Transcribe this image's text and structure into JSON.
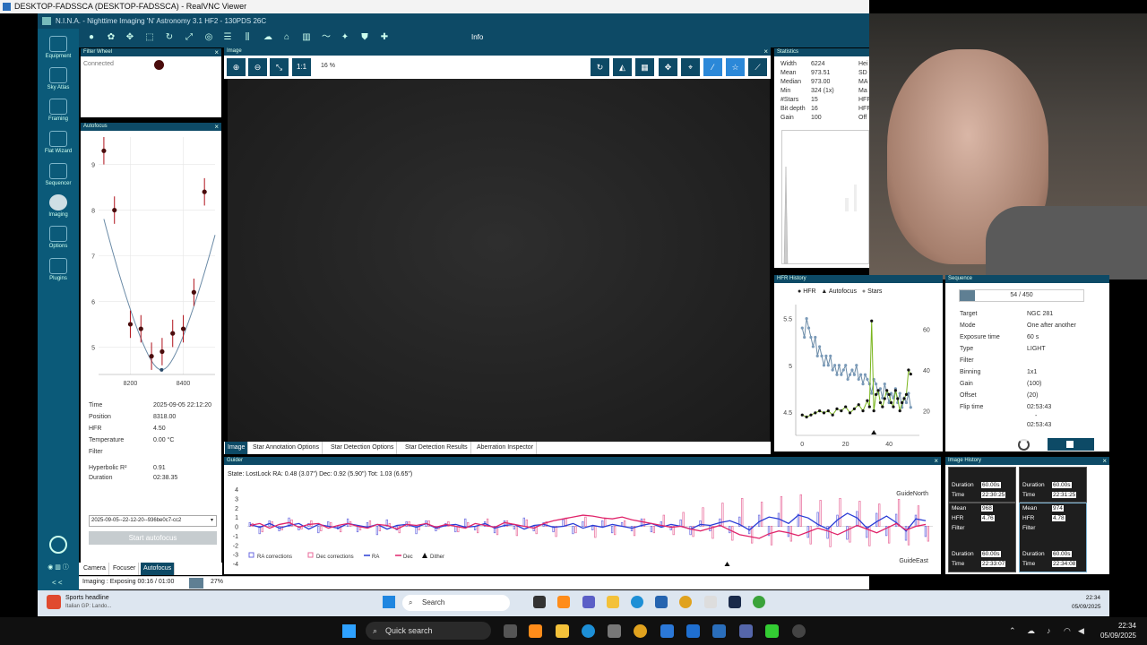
{
  "vnc": {
    "title": "DESKTOP-FADSSCA (DESKTOP-FADSSCA) - RealVNC Viewer"
  },
  "nina": {
    "title": "N.I.N.A. - Nighttime Imaging 'N' Astronomy 3.1 HF2 - 130PDS 26C"
  },
  "sidebar": {
    "items": [
      {
        "label": "Equipment",
        "icon": "camera-icon"
      },
      {
        "label": "Sky Atlas",
        "icon": "atlas-icon"
      },
      {
        "label": "Framing",
        "icon": "framing-icon"
      },
      {
        "label": "Flat Wizard",
        "icon": "flat-wizard-icon"
      },
      {
        "label": "Sequencer",
        "icon": "sequencer-icon"
      },
      {
        "label": "Imaging",
        "icon": "imaging-icon"
      },
      {
        "label": "Options",
        "icon": "gear-icon"
      },
      {
        "label": "Plugins",
        "icon": "puzzle-icon"
      }
    ],
    "collapse": "< <"
  },
  "toolbar": {
    "info_label": "Info"
  },
  "filter_wheel": {
    "title": "Filter Wheel",
    "status": "Connected"
  },
  "autofocus": {
    "title": "Autofocus",
    "rows": [
      {
        "label": "Time",
        "value": "2025-09-05 22:12:20"
      },
      {
        "label": "Position",
        "value": "8318.00"
      },
      {
        "label": "HFR",
        "value": "4.50"
      },
      {
        "label": "Temperature",
        "value": "0.00 °C"
      },
      {
        "label": "Filter",
        "value": ""
      },
      {
        "label": "Hyperbolic R²",
        "value": "0.91"
      },
      {
        "label": "Duration",
        "value": "02:38.35"
      }
    ],
    "selected_run": "2025-09-05--22-12-20--936be0c7-cc2",
    "start_label": "Start autofocus"
  },
  "left_tabs": [
    "Camera",
    "Focuser",
    "Autofocus"
  ],
  "image": {
    "title": "Image",
    "zoom": "16 %",
    "one_to_one": "1:1"
  },
  "image_tabs": [
    "Image",
    "Star Annotation Options",
    "Star Detection Options",
    "Star Detection Results",
    "Aberration Inspector"
  ],
  "statistics": {
    "title": "Statistics",
    "rows": [
      {
        "label": "Width",
        "value": "6224",
        "right": "Hei"
      },
      {
        "label": "Mean",
        "value": "973.51",
        "right": "SD"
      },
      {
        "label": "Median",
        "value": "973.00",
        "right": "MA"
      },
      {
        "label": "Min",
        "value": "324 (1x)",
        "right": "Ma"
      },
      {
        "label": "#Stars",
        "value": "15",
        "right": "HFF"
      },
      {
        "label": "Bit depth",
        "value": "16",
        "right": "HFF"
      },
      {
        "label": "Gain",
        "value": "100",
        "right": "Off"
      }
    ]
  },
  "hfr_history": {
    "title": "HFR History",
    "legend": [
      "HFR",
      "Autofocus",
      "Stars"
    ]
  },
  "sequence": {
    "title": "Sequence",
    "progress_text": "54 / 450",
    "progress_fraction": 0.12,
    "rows": [
      {
        "label": "Target",
        "value": "NGC 281"
      },
      {
        "label": "Mode",
        "value": "One after another"
      },
      {
        "label": "Exposure time",
        "value": "60 s"
      },
      {
        "label": "Type",
        "value": "LIGHT"
      },
      {
        "label": "Filter",
        "value": ""
      },
      {
        "label": "Binning",
        "value": "1x1"
      },
      {
        "label": "Gain",
        "value": "(100)"
      },
      {
        "label": "Offset",
        "value": "(20)"
      },
      {
        "label": "Flip time",
        "value": "02:53:43"
      }
    ],
    "flip_dash": "-",
    "flip_time2": "02:53:43"
  },
  "guider": {
    "title": "Guider",
    "state": "State: LostLock  RA: 0.48 (3.07\")  Dec: 0.92 (5.90\")  Tot: 1.03 (6.65\")",
    "north_label": "GuideNorth",
    "east_label": "GuideEast",
    "legend": [
      "RA corrections",
      "Dec corrections",
      "RA",
      "Dec",
      "Dither"
    ]
  },
  "image_history": {
    "title": "Image History",
    "cards": [
      {
        "k1": "Duration",
        "v1": "60.00s",
        "k2": "Time",
        "v2": "22:30:25"
      },
      {
        "k1": "Duration",
        "v1": "60.00s",
        "k2": "Time",
        "v2": "22:31:25"
      },
      {
        "k1": "Mean",
        "v1": "968",
        "k2": "HFR",
        "v2": "4.76",
        "k3": "Filter"
      },
      {
        "k1": "Mean",
        "v1": "974",
        "k2": "HFR",
        "v2": "4.78",
        "k3": "Filter"
      },
      {
        "k1": "Duration",
        "v1": "60.00s",
        "k2": "Time",
        "v2": "22:33:07"
      },
      {
        "k1": "Duration",
        "v1": "60.00s",
        "k2": "Time",
        "v2": "22:34:08"
      }
    ]
  },
  "status": {
    "imaging": "Imaging :  Exposing 00:16 / 01:00",
    "percent": "27%",
    "progress_fraction": 0.27
  },
  "remote_taskbar": {
    "news_title": "Sports headline",
    "news_sub": "Italian GP: Lando...",
    "search": "Search",
    "time": "22:34",
    "date": "05/09/2025"
  },
  "local_taskbar": {
    "search": "Quick search",
    "time": "22:34",
    "date": "05/09/2025"
  },
  "chart_data": [
    {
      "type": "scatter",
      "title": "Autofocus",
      "xlabel": "",
      "ylabel": "",
      "xlim": [
        8080,
        8520
      ],
      "ylim": [
        4.4,
        9.6
      ],
      "x_ticks": [
        8200,
        8400
      ],
      "y_ticks": [
        5,
        6,
        7,
        8,
        9
      ],
      "series": [
        {
          "x": [
            8100,
            8140,
            8200,
            8240,
            8280,
            8320,
            8360,
            8400,
            8440,
            8480
          ],
          "y": [
            9.3,
            8.0,
            5.5,
            5.4,
            4.8,
            4.9,
            5.3,
            5.4,
            6.2,
            8.4
          ]
        }
      ],
      "fit_min": {
        "x": 8318,
        "y": 4.5
      }
    },
    {
      "type": "line",
      "title": "HFR History",
      "x_ticks": [
        0,
        20,
        40
      ],
      "y_left_ticks": [
        4.5,
        5,
        5.5
      ],
      "y_right_ticks": [
        20,
        40,
        60
      ],
      "xlim": [
        -3,
        54
      ],
      "ylim": [
        4.25,
        5.65
      ],
      "y2lim": [
        8,
        72
      ],
      "series": [
        {
          "name": "HFR",
          "axis": "left",
          "x": [
            0,
            1,
            2,
            3,
            4,
            5,
            6,
            7,
            8,
            9,
            10,
            11,
            12,
            13,
            14,
            15,
            16,
            17,
            18,
            19,
            20,
            21,
            22,
            23,
            24,
            25,
            26,
            27,
            28,
            29,
            30,
            31,
            32,
            33,
            34,
            35,
            36,
            37,
            38,
            39,
            40,
            41,
            42,
            43,
            44,
            45,
            46,
            47,
            48,
            49,
            50
          ],
          "y": [
            5.4,
            5.3,
            5.5,
            5.4,
            5.3,
            5.2,
            5.3,
            5.1,
            5.2,
            5.1,
            5.0,
            5.1,
            5.0,
            5.1,
            4.95,
            5.0,
            4.9,
            5.0,
            4.9,
            4.95,
            5.0,
            4.85,
            4.9,
            4.95,
            4.9,
            5.0,
            4.85,
            4.9,
            4.8,
            4.9,
            4.85,
            4.8,
            4.7,
            4.85,
            4.8,
            4.7,
            4.75,
            4.65,
            4.8,
            4.7,
            4.6,
            4.7,
            4.65,
            4.75,
            4.6,
            4.7,
            4.55,
            4.65,
            4.6,
            4.7,
            4.55
          ]
        },
        {
          "name": "Stars",
          "axis": "right",
          "x": [
            0,
            2,
            4,
            6,
            8,
            10,
            12,
            14,
            16,
            18,
            20,
            22,
            24,
            26,
            28,
            30,
            31,
            32,
            33,
            34,
            35,
            36,
            37,
            38,
            39,
            40,
            41,
            42,
            43,
            44,
            45,
            46,
            47,
            48,
            49,
            50
          ],
          "y": [
            18,
            17,
            18,
            19,
            20,
            19,
            20,
            18,
            21,
            20,
            22,
            19,
            21,
            23,
            20,
            25,
            22,
            64,
            20,
            28,
            30,
            24,
            22,
            26,
            30,
            28,
            24,
            22,
            30,
            26,
            20,
            24,
            26,
            28,
            40,
            38
          ]
        }
      ],
      "autofocus_markers": [
        33
      ]
    },
    {
      "type": "line",
      "title": "Guider",
      "ylim": [
        -4,
        4
      ],
      "y_ticks": [
        4,
        3,
        2,
        1,
        0,
        -1,
        -2,
        -3,
        -4
      ],
      "series": [
        {
          "name": "RA corrections",
          "type": "bar",
          "values": [
            0.4,
            -0.8,
            0.6,
            -0.5,
            0.9,
            -0.4,
            0.3,
            -0.7,
            0.5,
            -0.3,
            0.8,
            -0.6,
            0.4,
            -0.9,
            0.7,
            -0.4,
            0.5,
            -0.8,
            0.6,
            -0.5,
            0.3,
            -0.6,
            0.8,
            -0.4,
            0.5,
            -0.7,
            0.6,
            -0.3,
            0.9,
            -0.5,
            0.4,
            -0.6,
            0.7,
            -0.8,
            0.5,
            -0.4,
            0.6,
            -0.7,
            0.4,
            -0.5,
            0.8,
            -0.6,
            0.5,
            -0.4,
            0.7,
            -0.9,
            0.6,
            -0.5,
            0.8,
            -0.7,
            1.0,
            -0.8,
            1.2,
            -1.0,
            1.4,
            -1.1,
            1.3,
            -1.2,
            1.5,
            -1.3,
            1.2,
            -1.4,
            1.6,
            -1.2,
            1.4,
            -1.0,
            1.3,
            -1.5,
            1.2,
            -1.1
          ]
        },
        {
          "name": "Dec corrections",
          "type": "bar",
          "values": [
            0.3,
            -0.6,
            0.5,
            -0.4,
            0.7,
            -0.3,
            0.6,
            -0.5,
            0.4,
            -0.6,
            0.5,
            -0.4,
            0.6,
            -0.5,
            0.3,
            -0.7,
            0.5,
            -0.4,
            0.6,
            -0.3,
            0.5,
            -0.6,
            0.4,
            -0.7,
            0.8,
            -0.9,
            0.6,
            -1.0,
            0.7,
            -0.8,
            0.5,
            -1.1,
            0.9,
            -0.7,
            1.0,
            -1.2,
            0.8,
            -0.9,
            0.6,
            -1.0,
            0.8,
            -0.7,
            1.2,
            -0.9,
            1.5,
            -1.1,
            2.0,
            -1.3,
            2.5,
            -1.5,
            3.0,
            -1.8,
            2.6,
            -2.0,
            3.2,
            -1.6,
            3.4,
            -1.9,
            2.8,
            -2.2,
            3.0,
            -1.7,
            2.7,
            -2.1,
            2.4,
            -1.8,
            2.9,
            -2.0,
            2.2,
            -1.6
          ]
        },
        {
          "name": "RA",
          "type": "line",
          "values": [
            0.2,
            -0.1,
            0.3,
            -0.2,
            0.1,
            0.3,
            -0.3,
            0.2,
            0.0,
            -0.2,
            0.3,
            0.1,
            -0.1,
            0.2,
            -0.3,
            0.1,
            0.2,
            -0.1,
            0.3,
            -0.2,
            0.1,
            0.2,
            -0.1,
            0.0,
            0.3,
            -0.2,
            0.1,
            0.2,
            -0.3,
            0.1,
            0.2,
            -0.1,
            0.0,
            0.3,
            -0.2,
            0.1,
            -0.1,
            0.2,
            0.0,
            -0.2,
            0.1,
            0.3,
            -0.1,
            0.2,
            0.0,
            -0.3,
            0.2,
            0.1,
            0.4,
            0.6,
            0.2,
            -0.4,
            0.5,
            1.0,
            0.8,
            0.3,
            1.2,
            0.9,
            0.2,
            -0.3,
            0.7,
            1.4,
            0.9,
            -0.2,
            0.5,
            1.1,
            0.4,
            -0.5,
            0.8,
            0.6
          ]
        },
        {
          "name": "Dec",
          "type": "line",
          "values": [
            0.1,
            0.3,
            -0.2,
            0.2,
            0.4,
            -0.1,
            0.2,
            0.3,
            -0.2,
            0.1,
            0.3,
            0.0,
            -0.2,
            0.2,
            0.1,
            -0.3,
            0.2,
            0.1,
            0.3,
            -0.1,
            0.2,
            0.0,
            -0.2,
            0.3,
            0.1,
            -0.1,
            0.4,
            0.2,
            0.0,
            -0.2,
            0.3,
            0.6,
            0.8,
            1.0,
            1.2,
            1.1,
            0.9,
            0.8,
            1.0,
            0.7,
            0.5,
            0.3,
            0.1,
            -0.1,
            0.0,
            -0.3,
            -0.5,
            -0.2,
            0.1,
            -0.4,
            -0.9,
            -1.1,
            -1.3,
            -0.8,
            -0.5,
            -0.7,
            -1.0,
            -0.6,
            -0.2,
            -0.5,
            -0.9,
            -0.4,
            0.1,
            -0.3,
            -0.7,
            -0.2,
            0.3,
            -0.4,
            0.0,
            0.2
          ]
        }
      ],
      "dither_markers": [
        0.7
      ]
    }
  ],
  "colors": {
    "nina_blue": "#0d4a66",
    "hfr_green": "#7ab51d",
    "hfr_line": "#6a8aa6",
    "ra_blue": "#2a3dd6",
    "dec_red": "#e0246a"
  }
}
